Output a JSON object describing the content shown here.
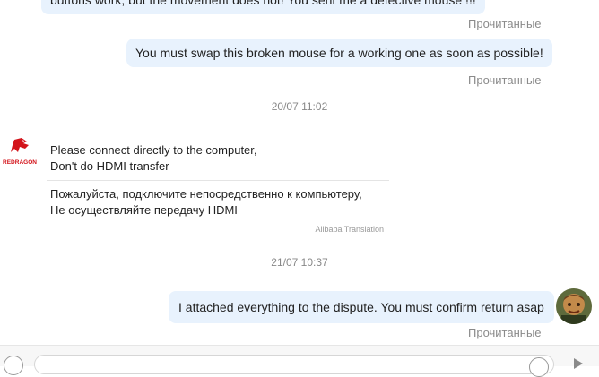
{
  "messages": [
    {
      "text": "buttons work, but the movement does not!  You sent me a defective mouse !!!",
      "status": "Прочитанные"
    },
    {
      "text": "You must swap this broken mouse for a working one as soon as possible!",
      "status": "Прочитанные"
    }
  ],
  "timestamp1": "20/07 11:02",
  "seller": {
    "logo_text": "REDRAGON",
    "original_line1": "Please connect directly to the computer,",
    "original_line2": "Don't do HDMI transfer",
    "translated_line1": "Пожалуйста, подключите непосредственно к компьютеру,",
    "translated_line2": "Не осуществляйте передачу HDMI",
    "translation_credit": "Alibaba Translation"
  },
  "timestamp2": "21/07 10:37",
  "last_message": {
    "text": "I attached everything to the dispute. You must confirm return asap",
    "status": "Прочитанные"
  },
  "colors": {
    "bubble": "#e8f2fd",
    "status_text": "#8a8a8a",
    "logo_red": "#d3131a"
  },
  "input": {
    "placeholder": ""
  }
}
